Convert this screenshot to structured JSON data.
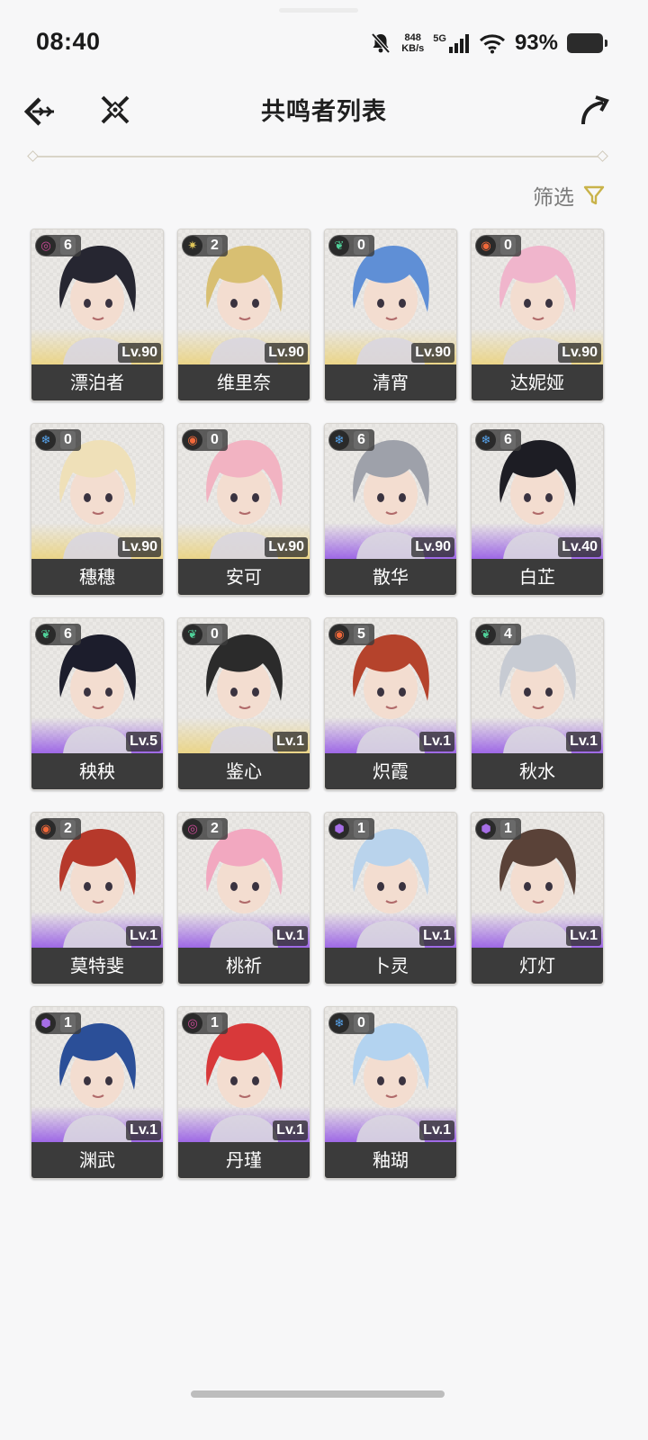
{
  "status_bar": {
    "time": "08:40",
    "net_speed_value": "848",
    "net_speed_unit": "KB/s",
    "network": "5G",
    "battery_percent": "93%"
  },
  "header": {
    "title": "共鸣者列表"
  },
  "filter": {
    "label": "筛选"
  },
  "colors": {
    "gold": "#ebd278",
    "purple": "#965ae6",
    "filter_icon": "#c9b34a"
  },
  "characters": [
    {
      "name": "漂泊者",
      "level": "Lv.90",
      "sequence": "6",
      "element": "havoc",
      "rarity": "gold"
    },
    {
      "name": "维里奈",
      "level": "Lv.90",
      "sequence": "2",
      "element": "spectro",
      "rarity": "gold"
    },
    {
      "name": "清宵",
      "level": "Lv.90",
      "sequence": "0",
      "element": "aero",
      "rarity": "gold"
    },
    {
      "name": "达妮娅",
      "level": "Lv.90",
      "sequence": "0",
      "element": "fusion",
      "rarity": "gold"
    },
    {
      "name": "穗穗",
      "level": "Lv.90",
      "sequence": "0",
      "element": "glacio",
      "rarity": "gold"
    },
    {
      "name": "安可",
      "level": "Lv.90",
      "sequence": "0",
      "element": "fusion",
      "rarity": "gold"
    },
    {
      "name": "散华",
      "level": "Lv.90",
      "sequence": "6",
      "element": "glacio",
      "rarity": "purple"
    },
    {
      "name": "白芷",
      "level": "Lv.40",
      "sequence": "6",
      "element": "glacio",
      "rarity": "purple"
    },
    {
      "name": "秧秧",
      "level": "Lv.5",
      "sequence": "6",
      "element": "aero",
      "rarity": "purple"
    },
    {
      "name": "鉴心",
      "level": "Lv.1",
      "sequence": "0",
      "element": "aero",
      "rarity": "gold"
    },
    {
      "name": "炽霞",
      "level": "Lv.1",
      "sequence": "5",
      "element": "fusion",
      "rarity": "purple"
    },
    {
      "name": "秋水",
      "level": "Lv.1",
      "sequence": "4",
      "element": "aero",
      "rarity": "purple"
    },
    {
      "name": "莫特斐",
      "level": "Lv.1",
      "sequence": "2",
      "element": "fusion",
      "rarity": "purple"
    },
    {
      "name": "桃祈",
      "level": "Lv.1",
      "sequence": "2",
      "element": "havoc",
      "rarity": "purple"
    },
    {
      "name": "卜灵",
      "level": "Lv.1",
      "sequence": "1",
      "element": "electro",
      "rarity": "purple"
    },
    {
      "name": "灯灯",
      "level": "Lv.1",
      "sequence": "1",
      "element": "electro",
      "rarity": "purple"
    },
    {
      "name": "渊武",
      "level": "Lv.1",
      "sequence": "1",
      "element": "electro",
      "rarity": "purple"
    },
    {
      "name": "丹瑾",
      "level": "Lv.1",
      "sequence": "1",
      "element": "havoc",
      "rarity": "purple"
    },
    {
      "name": "釉瑚",
      "level": "Lv.1",
      "sequence": "0",
      "element": "glacio",
      "rarity": "purple"
    }
  ]
}
